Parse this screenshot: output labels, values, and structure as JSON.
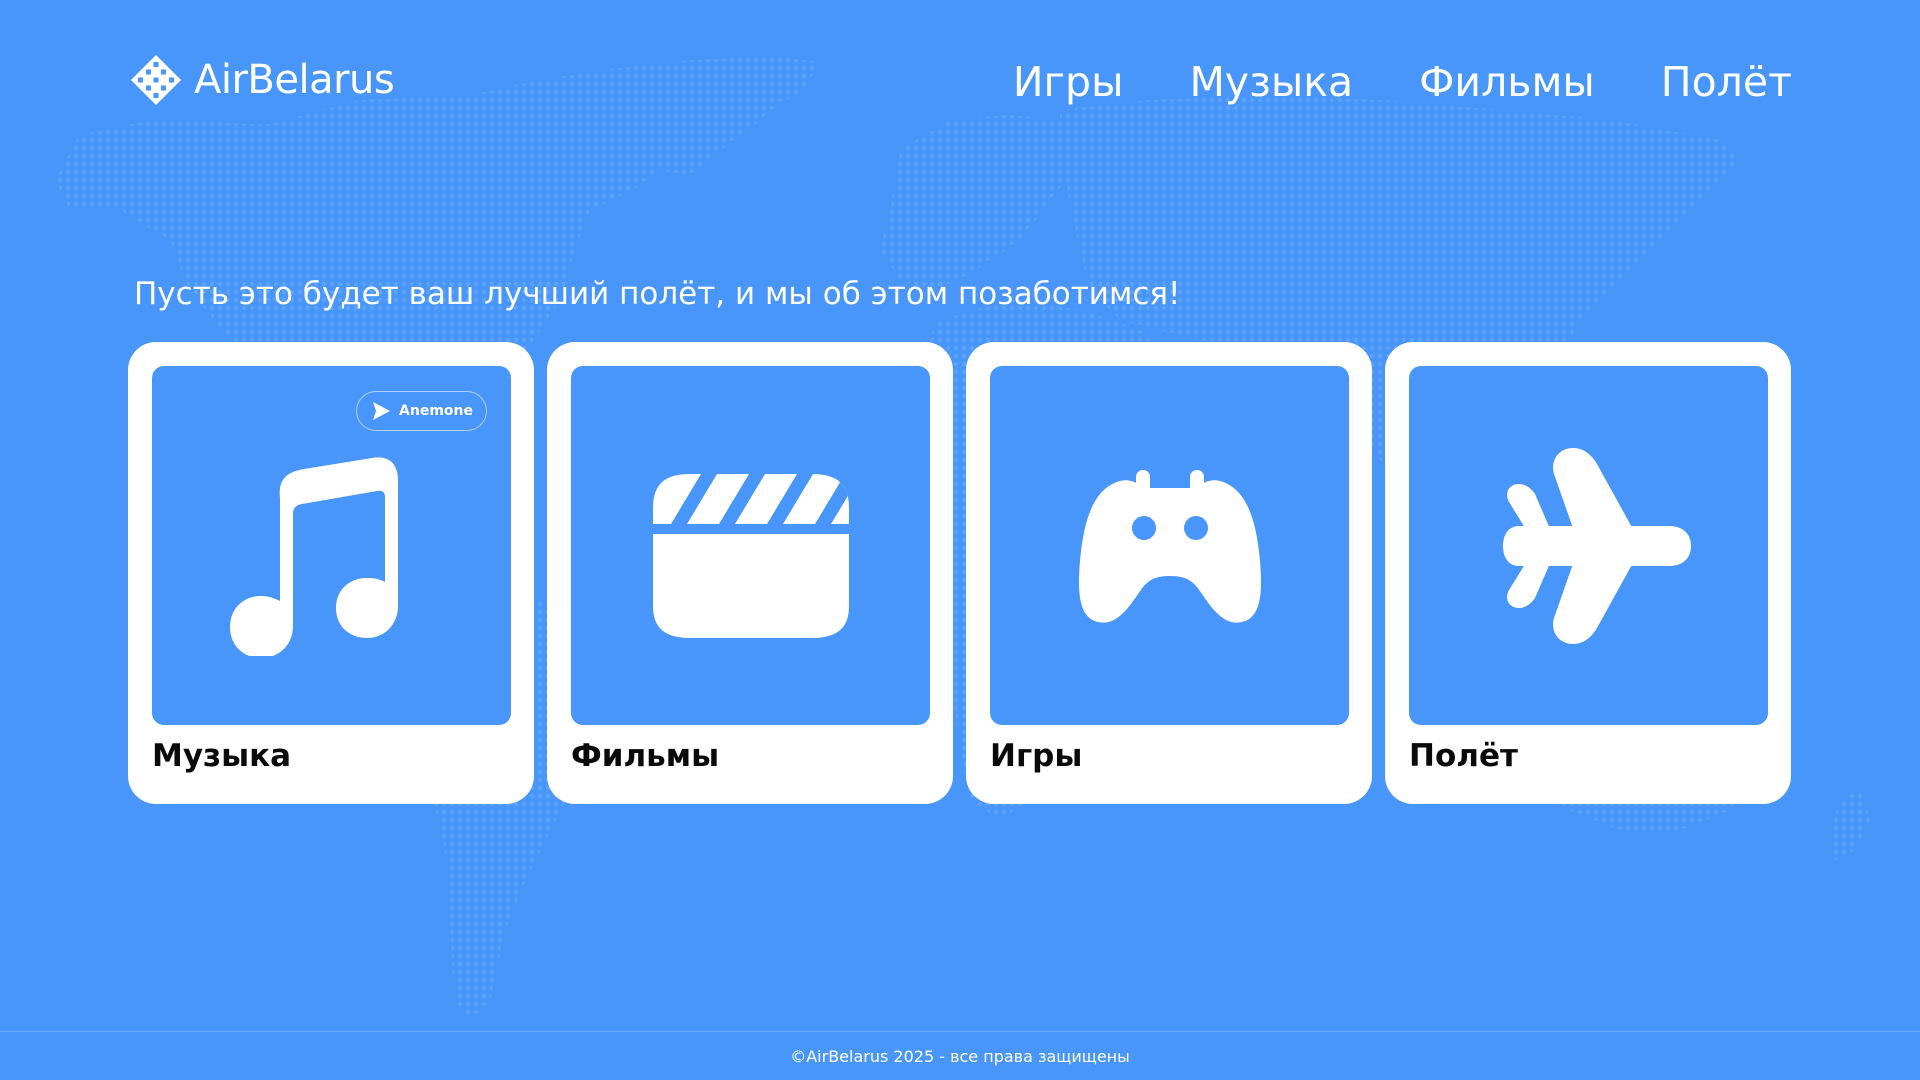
{
  "colors": {
    "background": "#4896fa",
    "card_background": "#ffffff",
    "card_title": "#0a0a0a",
    "map_dots": "#5ca3fb",
    "text_light": "#ffffff"
  },
  "header": {
    "logo_text": "AirBelarus",
    "logo_icon": "diamond-pattern-logo-icon"
  },
  "nav": {
    "items": [
      {
        "label": "Игры"
      },
      {
        "label": "Музыка"
      },
      {
        "label": "Фильмы"
      },
      {
        "label": "Полёт"
      }
    ]
  },
  "main": {
    "tagline": "Пусть это будет ваш лучший полёт, и мы об этом позаботимся!",
    "cards": [
      {
        "title": "Музыка",
        "icon": "music-note-icon",
        "badge": {
          "label": "Anemone",
          "icon": "play-arrow-icon"
        }
      },
      {
        "title": "Фильмы",
        "icon": "clapperboard-icon"
      },
      {
        "title": "Игры",
        "icon": "gamepad-icon"
      },
      {
        "title": "Полёт",
        "icon": "airplane-icon"
      }
    ]
  },
  "footer": {
    "copyright": "©AirBelarus 2025 - все права защищены"
  }
}
